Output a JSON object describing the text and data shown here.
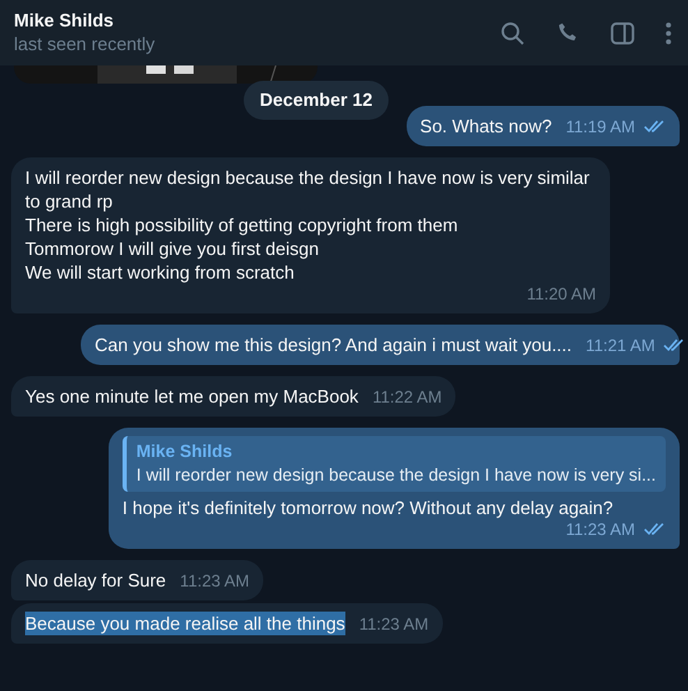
{
  "header": {
    "title": "Mike Shilds",
    "status": "last seen recently"
  },
  "date_pill": "December 12",
  "messages": [
    {
      "kind": "outgoing",
      "lines": [
        "So. Whats now?"
      ],
      "time": "11:19 AM",
      "read": true,
      "highlighted": false
    },
    {
      "kind": "incoming",
      "lines": [
        "I will reorder new design because the design I have now is very similar to grand rp",
        "There is high possibility of getting copyright from them",
        "Tommorow I will give you first deisgn",
        "We will start working from scratch"
      ],
      "time": "11:20 AM",
      "highlighted": false
    },
    {
      "kind": "outgoing",
      "lines": [
        "Can you show me this design? And again i must wait you...."
      ],
      "time": "11:21 AM",
      "read": true,
      "highlighted": false
    },
    {
      "kind": "incoming",
      "lines": [
        "Yes one minute let me open my MacBook"
      ],
      "time": "11:22 AM",
      "highlighted": false
    },
    {
      "kind": "outgoing",
      "reply": {
        "author": "Mike Shilds",
        "text": "I will reorder new design because the design I have now is very si..."
      },
      "lines": [
        "I hope it's definitely tomorrow now? Without any delay again?"
      ],
      "time": "11:23 AM",
      "read": true,
      "highlighted": false
    },
    {
      "kind": "incoming",
      "lines": [
        "No delay for Sure"
      ],
      "time": "11:23 AM",
      "highlighted": false
    },
    {
      "kind": "incoming",
      "lines": [
        "Because you made realise all the things"
      ],
      "time": "11:23 AM",
      "highlighted": true
    }
  ]
}
